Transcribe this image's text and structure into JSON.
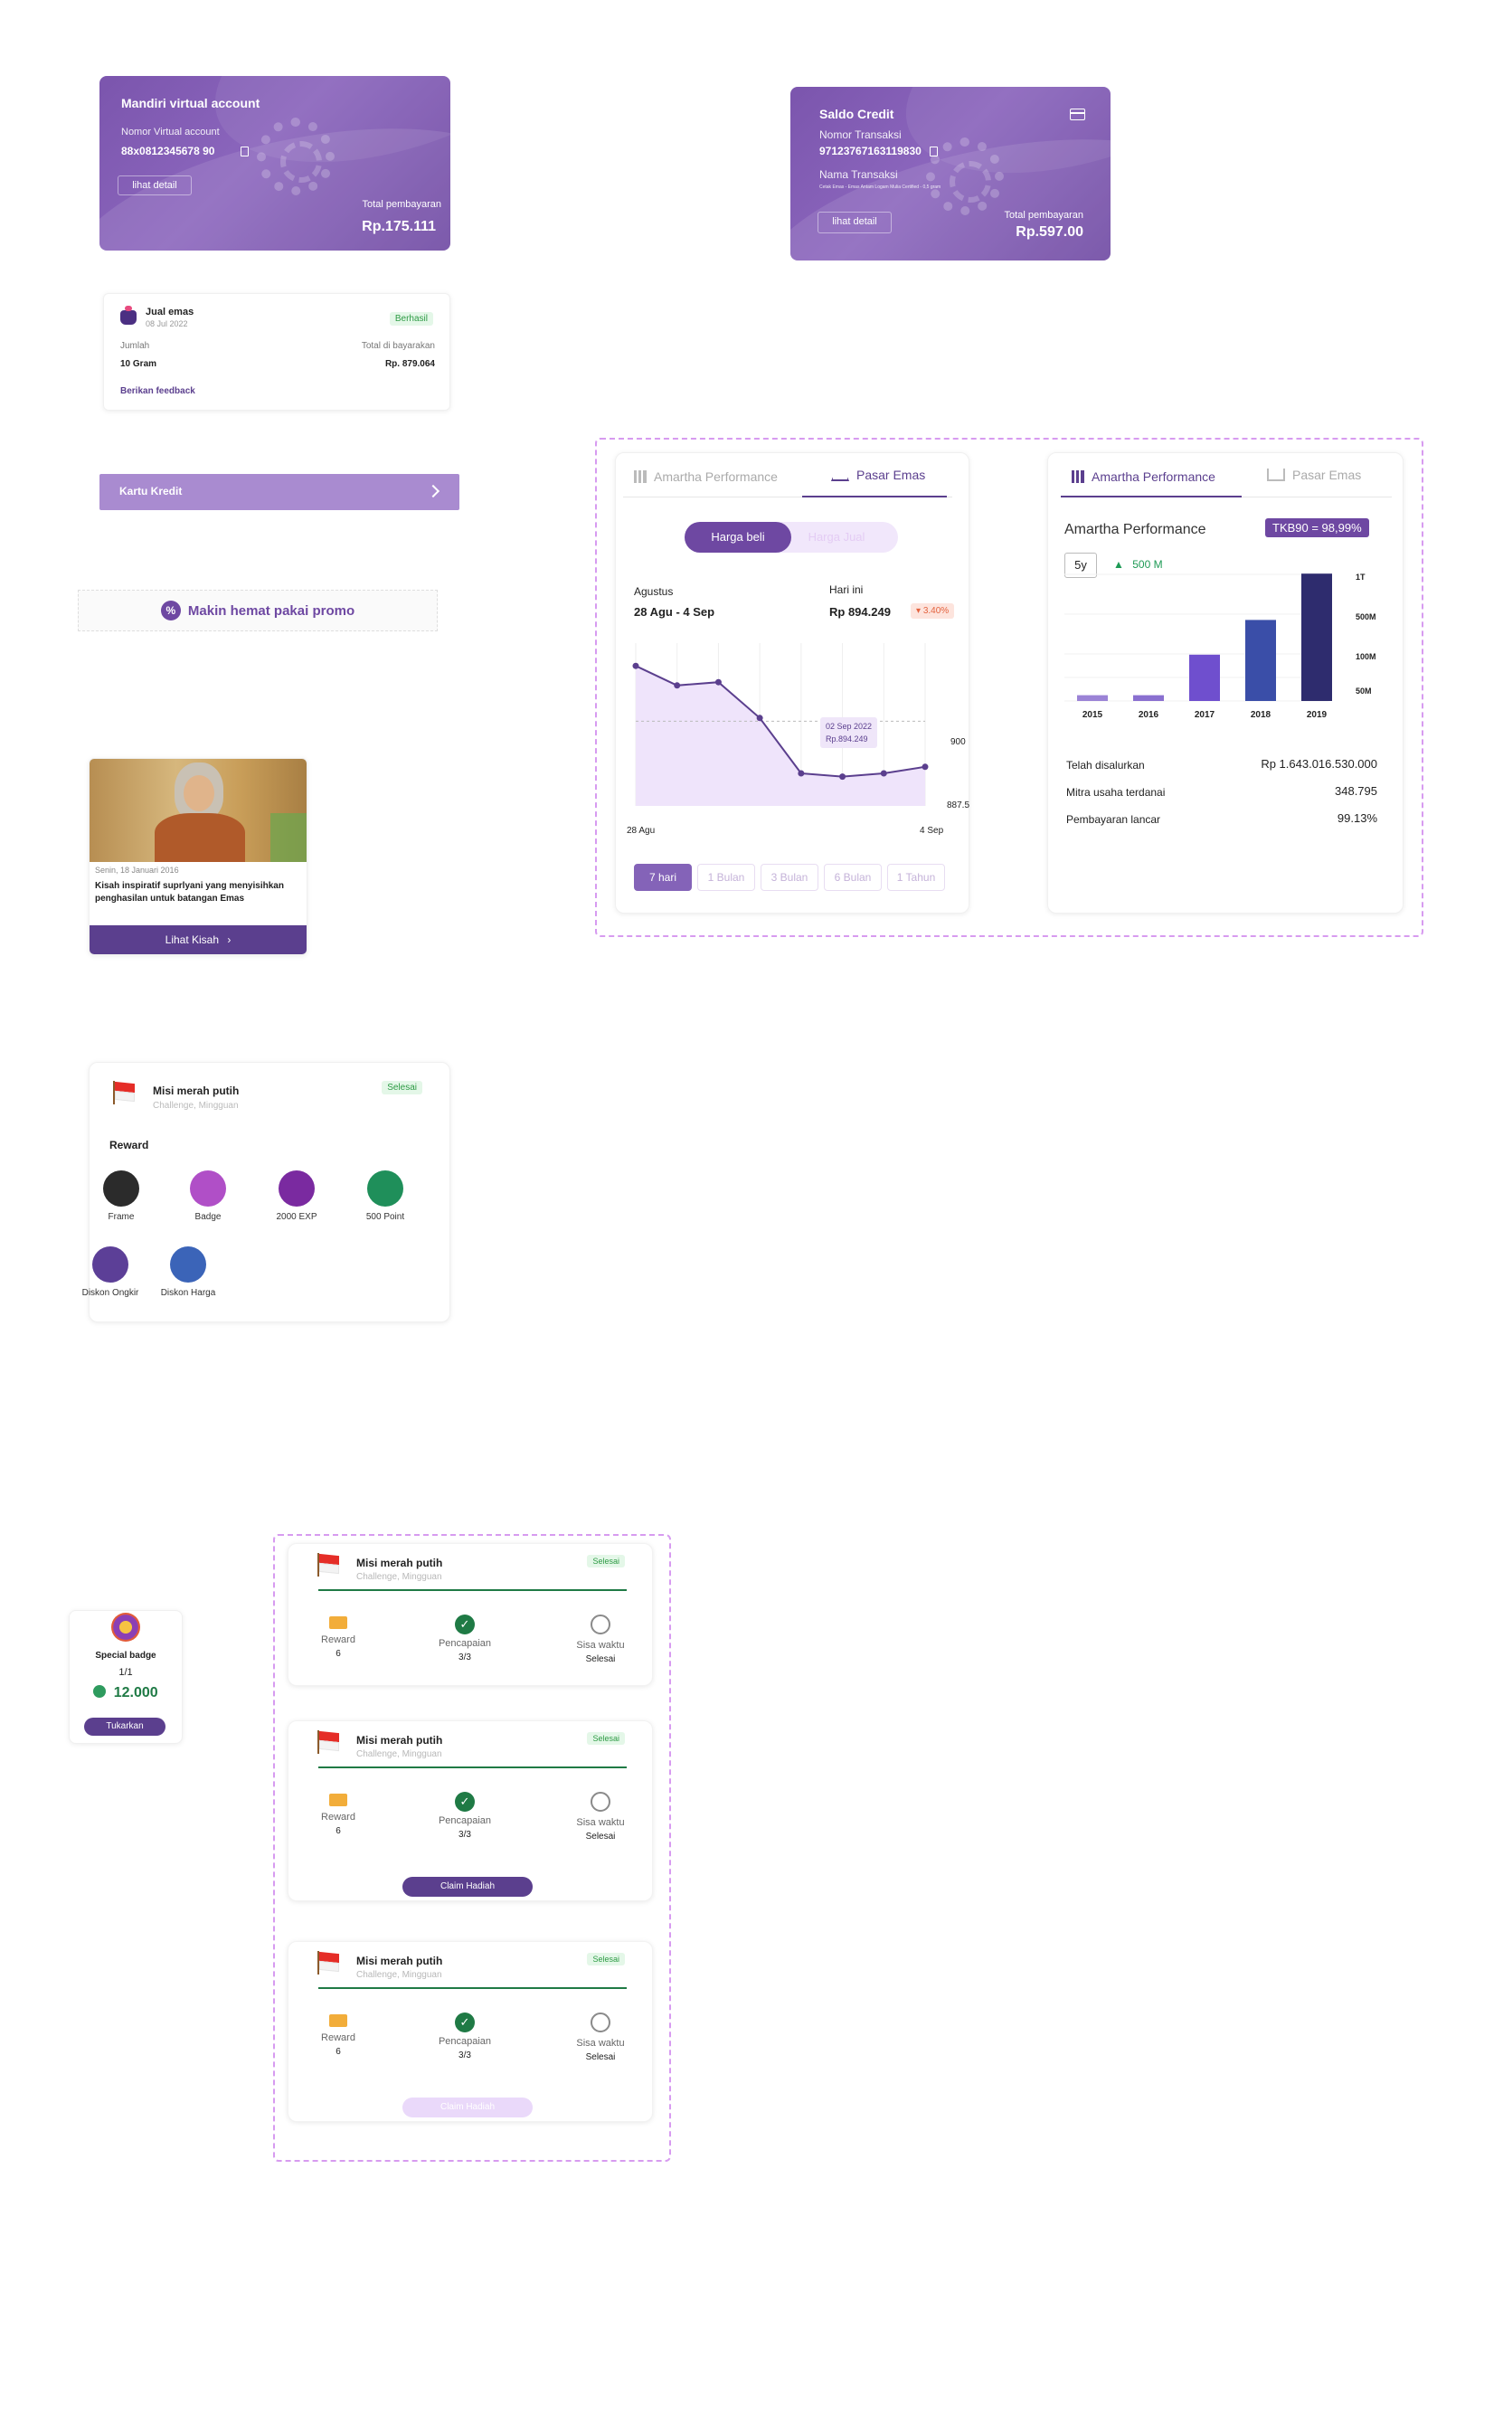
{
  "va_card": {
    "title": "Mandiri virtual account",
    "va_label": "Nomor Virtual account",
    "va_number": "88x0812345678 90",
    "detail_btn": "lihat detail",
    "total_label": "Total pembayaran",
    "total_value": "Rp.175.111"
  },
  "saldo_card": {
    "title": "Saldo Credit",
    "trx_label": "Nomor Transaksi",
    "trx_number": "97123767163119830",
    "name_label": "Nama Transaksi",
    "name_value": "Cetak Emas - Emas Antam Logam Mulia Certified - 0,5 gram",
    "detail_btn": "lihat detail",
    "total_label": "Total pembayaran",
    "total_value": "Rp.597.00"
  },
  "jual_card": {
    "title": "Jual emas",
    "date": "08 Jul 2022",
    "status": "Berhasil",
    "qty_label": "Jumlah",
    "qty_value": "10 Gram",
    "total_label": "Total di bayarakan",
    "total_value": "Rp. 879.064",
    "feedback": "Berikan feedback"
  },
  "kartu_kredit": {
    "label": "Kartu Kredit"
  },
  "promo": {
    "label": "Makin hemat pakai promo"
  },
  "story_card": {
    "date": "Senin, 18 Januari 2016",
    "text": "Kisah inspiratif suprlyani yang menyisihkan penghasilan untuk batangan Emas",
    "button": "Lihat Kisah"
  },
  "mission_card": {
    "title": "Misi merah putih",
    "subtitle": "Challenge, Mingguan",
    "status": "Selesai",
    "reward_heading": "Reward",
    "rewards": [
      {
        "label": "Frame",
        "icon": "frame-icon",
        "color": "#2b2b2b"
      },
      {
        "label": "Badge",
        "icon": "badge-icon",
        "color": "#b04fc7"
      },
      {
        "label": "2000 EXP",
        "icon": "exp-icon",
        "color": "#7a2aa0"
      },
      {
        "label": "500 Point",
        "icon": "point-icon",
        "color": "#1f8f5a"
      },
      {
        "label": "Diskon Ongkir",
        "icon": "shipping-discount-icon",
        "color": "#5c3f97"
      },
      {
        "label": "Diskon Harga",
        "icon": "price-discount-icon",
        "color": "#3b64b8"
      }
    ]
  },
  "gold_widget": {
    "tabs": [
      "Amartha Performance",
      "Pasar Emas"
    ],
    "toggle": [
      "Harga beli",
      "Harga Jual"
    ],
    "period_label": "Agustus",
    "period_range": "28 Agu - 4 Sep",
    "today_label": "Hari ini",
    "today_price": "Rp 894.249",
    "change": "3.40%",
    "tooltip_date": "02 Sep 2022",
    "tooltip_value": "Rp.894.249",
    "y_labels": [
      "900",
      "887.5"
    ],
    "x_start": "28 Agu",
    "x_end": "4 Sep",
    "periods": [
      "7 hari",
      "1 Bulan",
      "3 Bulan",
      "6 Bulan",
      "1 Tahun"
    ]
  },
  "perf_widget": {
    "tabs": [
      "Amartha Performance",
      "Pasar Emas"
    ],
    "heading": "Amartha Performance",
    "tkb": "TKB90 = 98,99%",
    "range_select": "5y",
    "growth": "500 M",
    "y_labels": [
      "1T",
      "500M",
      "100M",
      "50M"
    ],
    "stats": [
      {
        "label": "Telah disalurkan",
        "value": "Rp 1.643.016.530.000"
      },
      {
        "label": "Mitra usaha terdanai",
        "value": "348.795"
      },
      {
        "label": "Pembayaran lancar",
        "value": "99.13%"
      }
    ]
  },
  "chart_data": [
    {
      "type": "line",
      "title": "",
      "x": [
        "28 Agu",
        "29 Agu",
        "30 Agu",
        "31 Agu",
        "01 Sep",
        "02 Sep",
        "03 Sep",
        "4 Sep"
      ],
      "values": [
        906.5,
        903.5,
        904.0,
        898.5,
        890.0,
        889.5,
        890.0,
        891.0
      ],
      "ylim": [
        885,
        910
      ],
      "ylabel": "",
      "xlabel": "",
      "color": "#5b3f8e"
    },
    {
      "type": "bar",
      "title": "",
      "categories": [
        "2015",
        "2016",
        "2017",
        "2018",
        "2019"
      ],
      "values": [
        20,
        20,
        160,
        280,
        440
      ],
      "colors": [
        "#9b83d6",
        "#8a70d0",
        "#6f4fce",
        "#3a4ea8",
        "#2e2c6e"
      ],
      "ylabel": "",
      "xlabel": ""
    }
  ],
  "special_badge": {
    "title": "Special badge",
    "count": "1/1",
    "points": "12.000",
    "button": "Tukarkan"
  },
  "mission_list": [
    {
      "title": "Misi merah putih",
      "subtitle": "Challenge, Mingguan",
      "status": "Selesai",
      "reward_label": "Reward",
      "reward_value": "6",
      "progress_label": "Pencapaian",
      "progress_value": "3/3",
      "time_label": "Sisa waktu",
      "time_value": "Selesai",
      "button": ""
    },
    {
      "title": "Misi merah putih",
      "subtitle": "Challenge, Mingguan",
      "status": "Selesai",
      "reward_label": "Reward",
      "reward_value": "6",
      "progress_label": "Pencapaian",
      "progress_value": "3/3",
      "time_label": "Sisa waktu",
      "time_value": "Selesai",
      "button": "Claim Hadiah"
    },
    {
      "title": "Misi merah putih",
      "subtitle": "Challenge, Mingguan",
      "status": "Selesai",
      "reward_label": "Reward",
      "reward_value": "6",
      "progress_label": "Pencapaian",
      "progress_value": "3/3",
      "time_label": "Sisa waktu",
      "time_value": "Selesai",
      "button": "Claim Hadiah"
    }
  ]
}
